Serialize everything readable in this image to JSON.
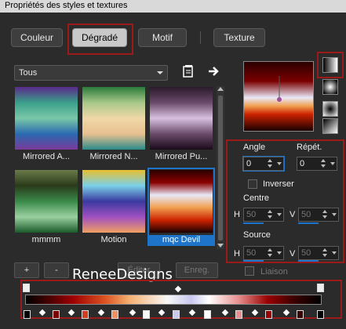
{
  "title": "Propriétés des styles et textures",
  "tabs": [
    {
      "label": "Couleur",
      "active": false
    },
    {
      "label": "Dégradé",
      "active": true
    },
    {
      "label": "Motif",
      "active": false
    },
    {
      "label": "Texture",
      "active": false
    }
  ],
  "category": {
    "selected": "Tous"
  },
  "gradients": [
    {
      "label": "Mirrored A...",
      "colors": [
        "#5a2a8a",
        "#3aa08a",
        "#7ac8a8",
        "#2a6ab0",
        "#7a3a9a"
      ]
    },
    {
      "label": "Mirrored N...",
      "colors": [
        "#2a7a3a",
        "#a8c88a",
        "#f0d8a8",
        "#e8c090",
        "#2a8a8a"
      ]
    },
    {
      "label": "Mirrored Pu...",
      "colors": [
        "#2a1a2a",
        "#6a4a6a",
        "#d8c0e0",
        "#6a4a6a",
        "#1a0a1a"
      ]
    },
    {
      "label": "mmmm",
      "colors": [
        "#6a7a4a",
        "#2a3a1a",
        "#3a8a4a",
        "#9ad0a0",
        "#1a5a2a"
      ]
    },
    {
      "label": "Motion",
      "colors": [
        "#e8c030",
        "#7ad0e8",
        "#3a3aa0",
        "#a050c0",
        "#f0a060"
      ]
    },
    {
      "label": "mqc Devil",
      "colors": [
        "#2a0000",
        "#8a0000",
        "#e8e8f8",
        "#f0a050",
        "#cc2200",
        "#1a0000"
      ],
      "selected": true
    }
  ],
  "params": {
    "angle_label": "Angle",
    "angle_value": "0",
    "repeat_label": "Répét.",
    "repeat_value": "0",
    "invert_label": "Inverser",
    "center_label": "Centre",
    "center_h": "50",
    "center_v": "50",
    "source_label": "Source",
    "source_h": "50",
    "source_v": "50",
    "h_label": "H",
    "v_label": "V"
  },
  "buttons": {
    "add": "+",
    "remove": "-",
    "edit": "Éditer",
    "save": "Enreg.",
    "link_label": "Liaison"
  },
  "watermark": "ReneeDesigns",
  "colors": {
    "accent": "#1e74c8",
    "highlight_frame": "#9b1b1b"
  }
}
